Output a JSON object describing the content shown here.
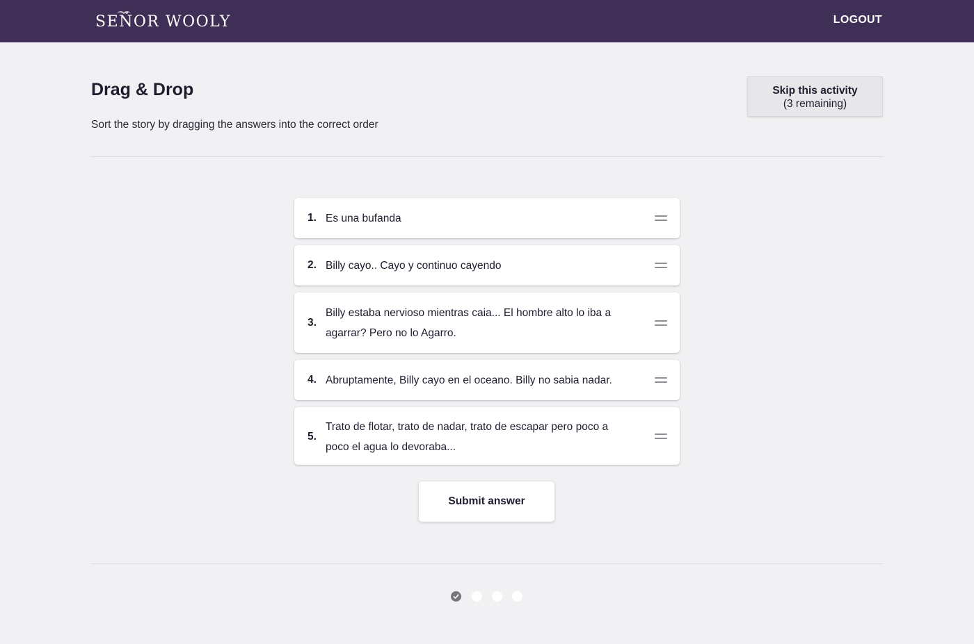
{
  "header": {
    "logo_text": "SEÑOR WOOLY",
    "logout_label": "LOGOUT",
    "background_color": "#3f2e55"
  },
  "activity": {
    "title": "Drag & Drop",
    "instructions": "Sort the story by dragging the answers into the correct order",
    "skip_label": "Skip this activity",
    "skip_remaining": "(3 remaining)"
  },
  "answers": [
    {
      "number": "1.",
      "text": "Es una bufanda"
    },
    {
      "number": "2.",
      "text": "Billy cayo.. Cayo y continuo cayendo"
    },
    {
      "number": "3.",
      "text": "Billy estaba nervioso mientras caia... El hombre alto lo iba a agarrar? Pero no lo Agarro."
    },
    {
      "number": "4.",
      "text": "Abruptamente, Billy cayo en el oceano. Billy no sabia nadar."
    },
    {
      "number": "5.",
      "text": "Trato de flotar, trato de nadar, trato de escapar pero poco a poco el agua lo devoraba..."
    }
  ],
  "submit_label": "Submit answer",
  "progress": {
    "total_steps": 4,
    "completed_steps": 1,
    "icons": {
      "completed": "check-icon"
    }
  }
}
